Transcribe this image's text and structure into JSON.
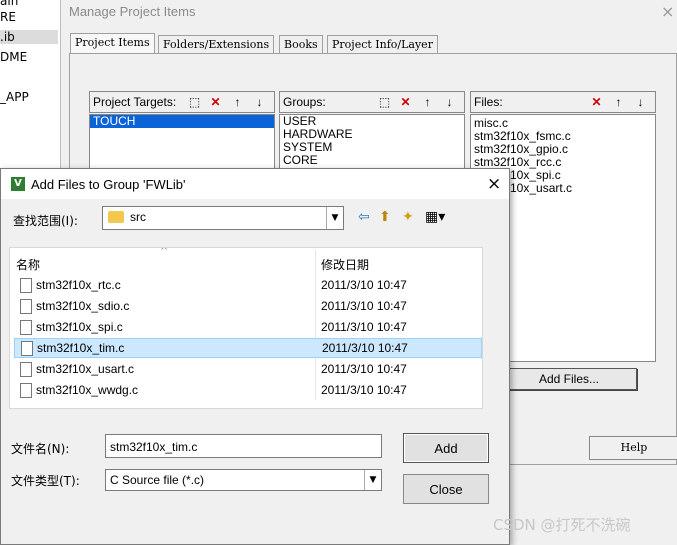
{
  "left_strip": {
    "items": [
      "ain",
      "RE",
      ".ib",
      "DME",
      "",
      "_APP"
    ]
  },
  "manage": {
    "title": "Manage Project Items",
    "close_icon": "×",
    "tabs": [
      "Project Items",
      "Folders/Extensions",
      "Books",
      "Project Info/Layer"
    ],
    "targets": {
      "label": "Project Targets:",
      "items": [
        "TOUCH"
      ]
    },
    "groups": {
      "label": "Groups:",
      "items": [
        "USER",
        "HARDWARE",
        "SYSTEM",
        "CORE"
      ]
    },
    "files": {
      "label": "Files:",
      "items": [
        "misc.c",
        "stm32f10x_fsmc.c",
        "stm32f10x_gpio.c",
        "stm32f10x_rcc.c",
        "stm32f10x_spi.c",
        "stm32f10x_usart.c"
      ]
    },
    "add_files_label": "Add Files...",
    "help_label": "Help"
  },
  "dialog": {
    "title": "Add Files to Group 'FWLib'",
    "app_icon": "V",
    "close_icon": "×",
    "lookin_label": "查找范围(I):",
    "lookin_value": "src",
    "col_name": "名称",
    "col_date": "修改日期",
    "files": [
      {
        "name": "stm32f10x_rtc.c",
        "date": "2011/3/10 10:47"
      },
      {
        "name": "stm32f10x_sdio.c",
        "date": "2011/3/10 10:47"
      },
      {
        "name": "stm32f10x_spi.c",
        "date": "2011/3/10 10:47"
      },
      {
        "name": "stm32f10x_tim.c",
        "date": "2011/3/10 10:47"
      },
      {
        "name": "stm32f10x_usart.c",
        "date": "2011/3/10 10:47"
      },
      {
        "name": "stm32f10x_wwdg.c",
        "date": "2011/3/10 10:47"
      }
    ],
    "selected_index": 3,
    "filename_label": "文件名(N):",
    "filename_value": "stm32f10x_tim.c",
    "filetype_label": "文件类型(T):",
    "filetype_value": "C Source file (*.c)",
    "add_label": "Add",
    "close_label": "Close"
  },
  "watermark": "CSDN @打死不洗碗"
}
